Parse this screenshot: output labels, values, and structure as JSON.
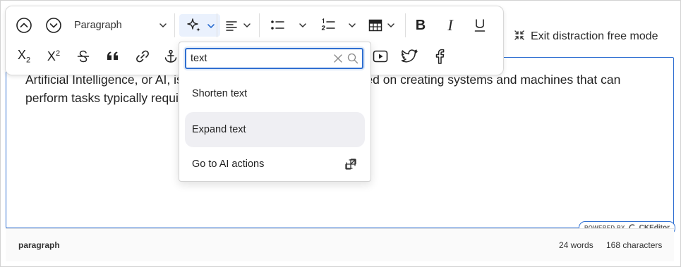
{
  "toolbar": {
    "heading_select": "Paragraph",
    "items": [
      "nav-up",
      "nav-down",
      "paragraph-select",
      "ai-assistant",
      "align",
      "bulleted-list",
      "numbered-list",
      "table",
      "bold",
      "italic",
      "underline",
      "subscript",
      "superscript",
      "strikethrough",
      "blockquote",
      "link",
      "anchor",
      "media-embed",
      "twitter",
      "facebook"
    ]
  },
  "header": {
    "exit_label": "Exit distraction free mode"
  },
  "editor": {
    "text": "Artificial Intelligence, or AI, is a field of computer science focused on creating systems and machines that can perform tasks typically requiring human intelligence."
  },
  "ai_dropdown": {
    "search_value": "text",
    "items": [
      {
        "label": "Shorten text"
      },
      {
        "label": "Expand text"
      },
      {
        "label": "Go to AI actions"
      }
    ]
  },
  "badge": {
    "powered": "POWERED BY",
    "brand": "CKEditor"
  },
  "status": {
    "path": "paragraph",
    "words": "24 words",
    "chars": "168 characters"
  },
  "colors": {
    "accent": "#2f6fd1",
    "highlight": "#efeff3",
    "ai_active": "#eaf1fd"
  }
}
